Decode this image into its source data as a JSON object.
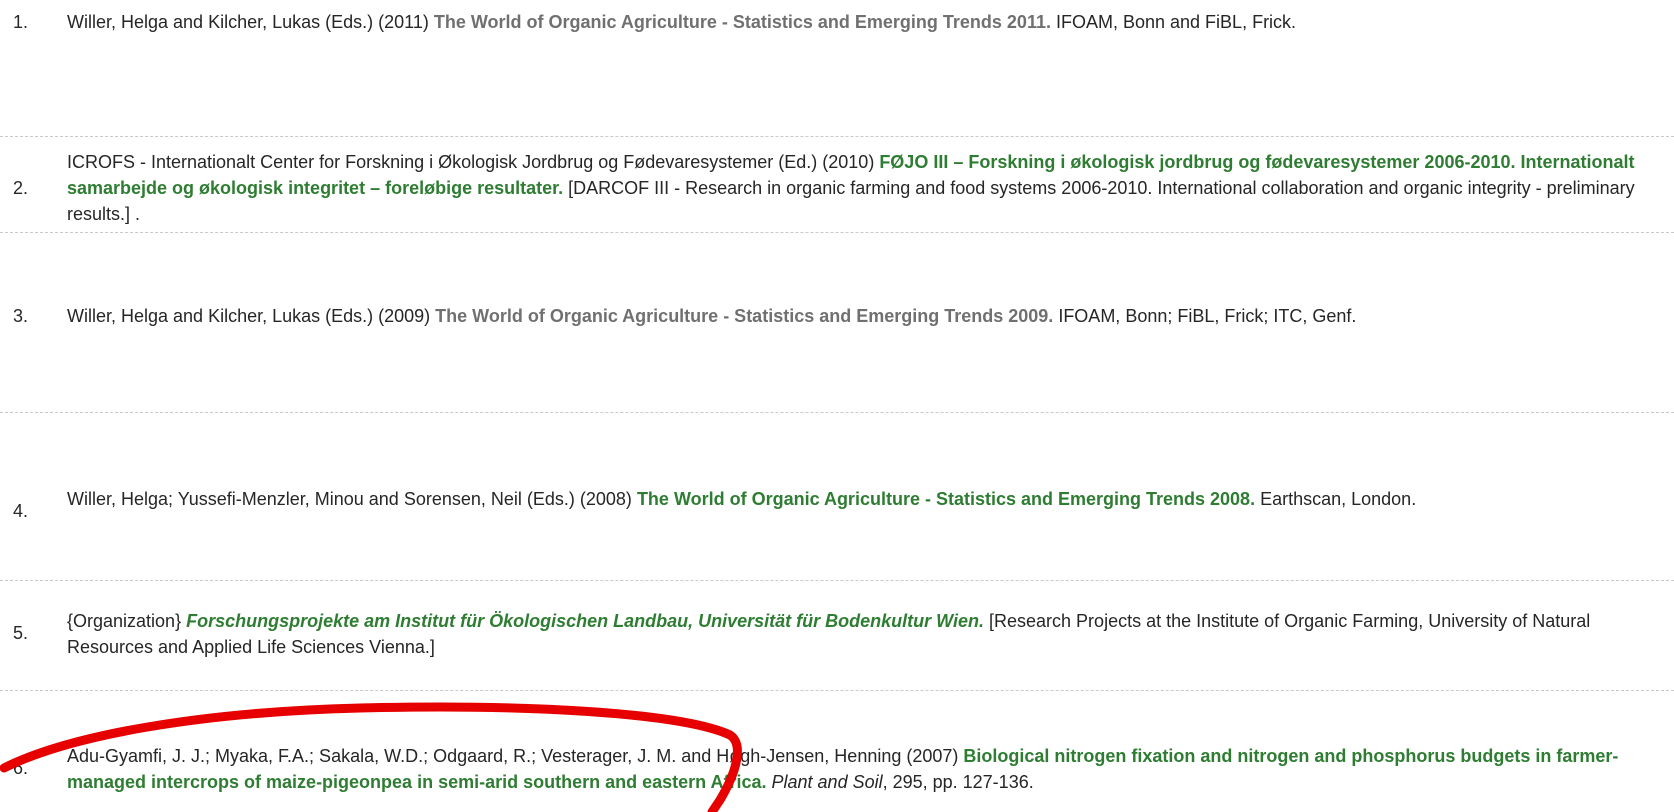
{
  "results": [
    {
      "number": "1.",
      "before": "Willer, Helga and Kilcher, Lukas (Eds.) (2011) ",
      "title": "The World of Organic Agriculture - Statistics and Emerging Trends 2011.",
      "after": " IFOAM, Bonn and FiBL, Frick."
    },
    {
      "number": "2.",
      "before": "ICROFS - Internationalt Center for Forskning i Økologisk Jordbrug og Fødevaresystemer (Ed.) (2010) ",
      "title": "FØJO III – Forskning i økologisk jordbrug og fødevaresystemer 2006-2010. Internationalt samarbejde og økologisk integritet – foreløbige resultater.",
      "after": " [DARCOF III - Research in organic farming and food systems 2006-2010. International collaboration and organic integrity - preliminary results.] ."
    },
    {
      "number": "3.",
      "before": "Willer, Helga and Kilcher, Lukas (Eds.) (2009) ",
      "title": "The World of Organic Agriculture - Statistics and Emerging Trends 2009.",
      "after": " IFOAM, Bonn; FiBL, Frick; ITC, Genf."
    },
    {
      "number": "4.",
      "before": "Willer, Helga; Yussefi-Menzler, Minou and Sorensen, Neil (Eds.) (2008) ",
      "title": "The World of Organic Agriculture - Statistics and Emerging Trends 2008.",
      "after": " Earthscan, London."
    },
    {
      "number": "5.",
      "before": "{Organization} ",
      "title": "Forschungsprojekte am Institut für Ökologischen Landbau, Universität für Bodenkultur Wien.",
      "after": " [Research Projects at the Institute of Organic Farming, University of Natural Resources and Applied Life Sciences Vienna.]"
    },
    {
      "number": "6.",
      "before": "Adu-Gyamfi, J. J.; Myaka, F.A.; Sakala, W.D.; Odgaard, R.; Vesterager, J. M. and Høgh-Jensen, Henning (2007) ",
      "title": "Biological nitrogen fixation and nitrogen and phosphorus budgets in farmer-managed intercrops of maize-pigeonpea in semi-arid southern and eastern Africa.",
      "journal": "Plant and Soil",
      "after": ", 295, pp. 127-136."
    }
  ],
  "colors": {
    "text": "#262626",
    "green_link": "#2e7d32",
    "grey_link": "#707070",
    "divider": "#c9c9c9",
    "annotation": "#e60000"
  }
}
